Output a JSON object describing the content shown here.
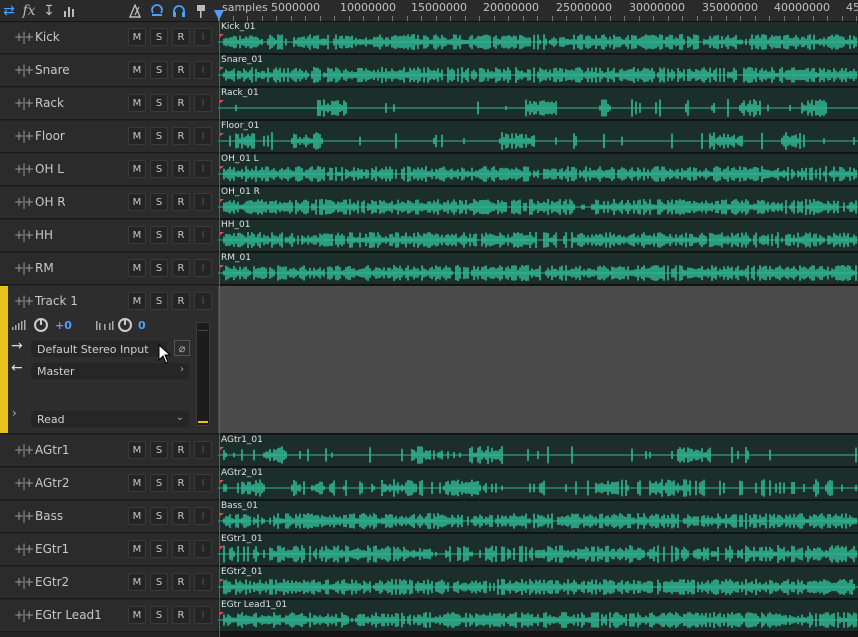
{
  "ruler": {
    "unit": "samples",
    "labels": [
      "5000000",
      "10000000",
      "15000000",
      "20000000",
      "25000000",
      "30000000",
      "35000000",
      "40000000",
      "45"
    ]
  },
  "toolbar_icons": [
    "swap-arrows-icon",
    "fx-icon",
    "insert-icon",
    "meter-bars-icon",
    "metronome-icon",
    "loop-icon",
    "headphones-icon",
    "flag-icon"
  ],
  "toolbar": {
    "fx": "fx"
  },
  "colors": {
    "waveform": "#2fb894",
    "lane_bg": "#1c2e29",
    "selected_strip": "#e8c21a",
    "accent": "#4aa0ff",
    "playhead": "#d03030"
  },
  "track_buttons": {
    "mute": "M",
    "solo": "S",
    "record": "R",
    "input": "I"
  },
  "tracks_top": [
    {
      "name": "Kick",
      "clip": "Kick_01"
    },
    {
      "name": "Snare",
      "clip": "Snare_01"
    },
    {
      "name": "Rack",
      "clip": "Rack_01"
    },
    {
      "name": "Floor",
      "clip": "Floor_01"
    },
    {
      "name": "OH L",
      "clip": "OH_01 L"
    },
    {
      "name": "OH R",
      "clip": "OH_01 R"
    },
    {
      "name": "HH",
      "clip": "HH_01"
    },
    {
      "name": "RM",
      "clip": "RM_01"
    }
  ],
  "selected_track": {
    "name": "Track 1",
    "volume": "+0",
    "pan": "0",
    "input": "Default Stereo Input",
    "output": "Master",
    "automation": "Read"
  },
  "tracks_bottom": [
    {
      "name": "AGtr1",
      "clip": "AGtr1_01"
    },
    {
      "name": "AGtr2",
      "clip": "AGtr2_01"
    },
    {
      "name": "Bass",
      "clip": "Bass_01"
    },
    {
      "name": "EGtr1",
      "clip": "EGtr1_01"
    },
    {
      "name": "EGtr2",
      "clip": "EGtr2_01"
    },
    {
      "name": "EGtr Lead1",
      "clip": "EGtr Lead1_01"
    }
  ]
}
